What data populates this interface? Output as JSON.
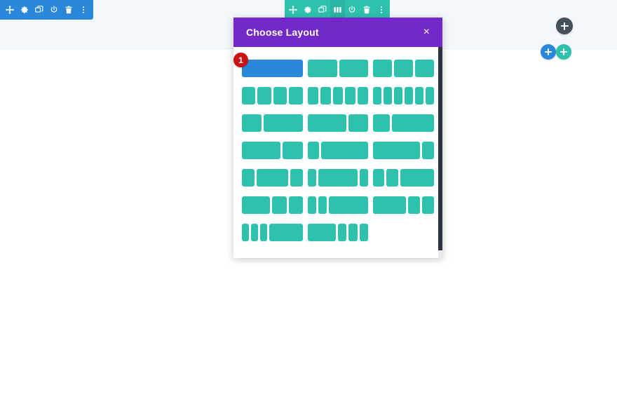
{
  "page": {
    "background_color": "#ffffff",
    "section_band_color": "#f4f7fc"
  },
  "module_toolbar": {
    "color": "#2b87da",
    "buttons": [
      {
        "name": "move-icon",
        "title": "Move Module"
      },
      {
        "name": "gear-icon",
        "title": "Module Settings"
      },
      {
        "name": "duplicate-icon",
        "title": "Duplicate Module"
      },
      {
        "name": "power-icon",
        "title": "Disable Module"
      },
      {
        "name": "trash-icon",
        "title": "Delete Module"
      },
      {
        "name": "kebab-menu-icon",
        "title": "More Options"
      }
    ]
  },
  "row_toolbar": {
    "color": "#2ec2ae",
    "active_index": 3,
    "buttons": [
      {
        "name": "move-icon",
        "title": "Move Row"
      },
      {
        "name": "gear-icon",
        "title": "Row Settings"
      },
      {
        "name": "duplicate-icon",
        "title": "Duplicate Row"
      },
      {
        "name": "columns-icon",
        "title": "Change Column Structure"
      },
      {
        "name": "power-icon",
        "title": "Disable Row"
      },
      {
        "name": "trash-icon",
        "title": "Delete Row"
      },
      {
        "name": "kebab-menu-icon",
        "title": "More Options"
      }
    ]
  },
  "add_buttons": [
    {
      "name": "add-section-button",
      "label": "+",
      "color": "#44505c",
      "title": "Add New Section"
    },
    {
      "name": "add-row-button",
      "label": "+",
      "color": "#2b87da",
      "title": "Add New Row"
    },
    {
      "name": "add-module-button",
      "label": "+",
      "color": "#2ec2ae",
      "title": "Add New Module"
    }
  ],
  "modal": {
    "title": "Choose Layout",
    "close_label": "×",
    "header_color": "#7328c9",
    "column_color": "#2ec2ae",
    "selected_color": "#2b87da",
    "badge": {
      "name": "step-badge",
      "text": "1",
      "color": "#cc1111"
    },
    "scrollbar": {
      "name": "modal-scrollbar",
      "color": "#2b3440"
    },
    "layouts": [
      [
        {
          "name": "layout-1-column",
          "widths": [
            100
          ],
          "selected": true,
          "badge": true
        },
        {
          "name": "layout-2-columns",
          "widths": [
            50,
            50
          ],
          "selected": false,
          "badge": false
        },
        {
          "name": "layout-3-columns",
          "widths": [
            33.33,
            33.33,
            33.33
          ],
          "selected": false,
          "badge": false
        }
      ],
      [
        {
          "name": "layout-4-columns",
          "widths": [
            25,
            25,
            25,
            25
          ],
          "selected": false,
          "badge": false
        },
        {
          "name": "layout-5-columns",
          "widths": [
            20,
            20,
            20,
            20,
            20
          ],
          "selected": false,
          "badge": false
        },
        {
          "name": "layout-6-columns",
          "widths": [
            16.6,
            16.6,
            16.6,
            16.6,
            16.6,
            16.6
          ],
          "selected": false,
          "badge": false
        }
      ],
      [
        {
          "name": "layout-third-twothirds",
          "widths": [
            33.33,
            66.67
          ],
          "selected": false,
          "badge": false
        },
        {
          "name": "layout-twothirds-third",
          "widths": [
            66.67,
            33.33
          ],
          "selected": false,
          "badge": false
        },
        {
          "name": "layout-quarter-threequarters",
          "widths": [
            28,
            72
          ],
          "selected": false,
          "badge": false
        }
      ],
      [
        {
          "name": "layout-twothirds-third-b",
          "widths": [
            66,
            34
          ],
          "selected": false,
          "badge": false
        },
        {
          "name": "layout-quarter-rest",
          "widths": [
            20,
            80
          ],
          "selected": false,
          "badge": false
        },
        {
          "name": "layout-rest-quarter",
          "widths": [
            80,
            20
          ],
          "selected": false,
          "badge": false
        }
      ],
      [
        {
          "name": "layout-quarter-half-quarter",
          "widths": [
            22,
            56,
            22
          ],
          "selected": false,
          "badge": false
        },
        {
          "name": "layout-fifth-center-fifth",
          "widths": [
            15,
            70,
            15
          ],
          "selected": false,
          "badge": false
        },
        {
          "name": "layout-quarter-quarter-half",
          "widths": [
            20,
            20,
            60
          ],
          "selected": false,
          "badge": false
        }
      ],
      [
        {
          "name": "layout-half-quarter-quarter",
          "widths": [
            50,
            25,
            25
          ],
          "selected": false,
          "badge": false
        },
        {
          "name": "layout-fifth-fifth-rest",
          "widths": [
            15,
            15,
            70
          ],
          "selected": false,
          "badge": false
        },
        {
          "name": "layout-half-fifth-fifth",
          "widths": [
            58,
            21,
            21
          ],
          "selected": false,
          "badge": false
        }
      ],
      [
        {
          "name": "layout-three-narrow-one-wide",
          "widths": [
            13,
            13,
            13,
            61
          ],
          "selected": false,
          "badge": false
        },
        {
          "name": "layout-one-wide-three-narrow",
          "widths": [
            52,
            16,
            16,
            16
          ],
          "selected": false,
          "badge": false
        }
      ]
    ]
  }
}
